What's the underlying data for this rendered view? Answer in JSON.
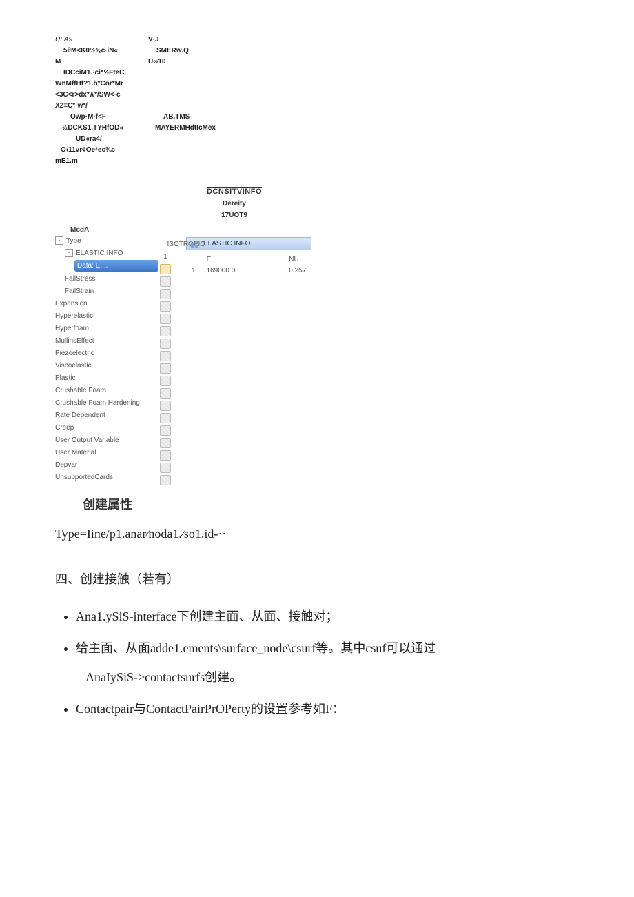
{
  "garble": {
    "l0": "UΓA9",
    "l1": "5θM<K0½⅜c·iN«",
    "l2": "M",
    "l3": "IDCciM1.·ci*½FteC",
    "l4": "WnMffHf?1.h*Cor*Mr",
    "l5": "<3C<r>dx*∧*/SW<·c",
    "l6": "X2≡C*·w*/",
    "l7": "Owp·M·f<F",
    "l8": "½DCKS1.TYHfOD«",
    "l9": "UD«ra4/",
    "l10": "O‹11vr¢Oe*ec⅜c",
    "l11": "mE1.m",
    "r0": "V·J",
    "r1": "SMERw.Q",
    "r2": "U∞10",
    "r3": "AB,TMS-",
    "r4": "MAYERMHdtIcMex"
  },
  "density": {
    "title": "DCNSITVINFO",
    "sub1": "Dereity",
    "sub2": "17UOT9"
  },
  "tree": {
    "head": "McdA",
    "type_label": "Type",
    "type_value": "ISOTROPIC",
    "elastic": "ELASTIC INFO",
    "current": "Data: E,...",
    "current_val": "1",
    "items": [
      "FailStress",
      "FailStrain",
      "Expansion",
      "Hyperelastic",
      "Hyperfoam",
      "MullinsEffect",
      "Piezoelectric",
      "Viscoelastic",
      "Plastic",
      "Crushable Foam",
      "Crushable Foam Hardening",
      "Rate Dependent",
      "Creep",
      "User Output Variable",
      "User Material",
      "Depvar",
      "UnsupportedCards"
    ]
  },
  "table": {
    "title": "ELASTIC INFO",
    "cols": [
      "",
      "E",
      "NU"
    ],
    "row": [
      "1",
      "169000.0",
      "0.257"
    ]
  },
  "caption": "创建属性",
  "typeLine": "Type=Iine/p1.anar⁄noda1.⁄so1.id-··",
  "sectionTitle": "四、创建接触（若有）",
  "bullets": {
    "b1": "Ana1.ySiS-interface下创建主面、从面、接触对；",
    "b2a": "给主面、从面adde1.ements\\surface_node\\csurf等。其中csuf可以通过",
    "b2b": "AnaIySiS->contactsurfs创建。",
    "b3": "Contactpair与ContactPairPrOPerty的设置参考如F："
  }
}
